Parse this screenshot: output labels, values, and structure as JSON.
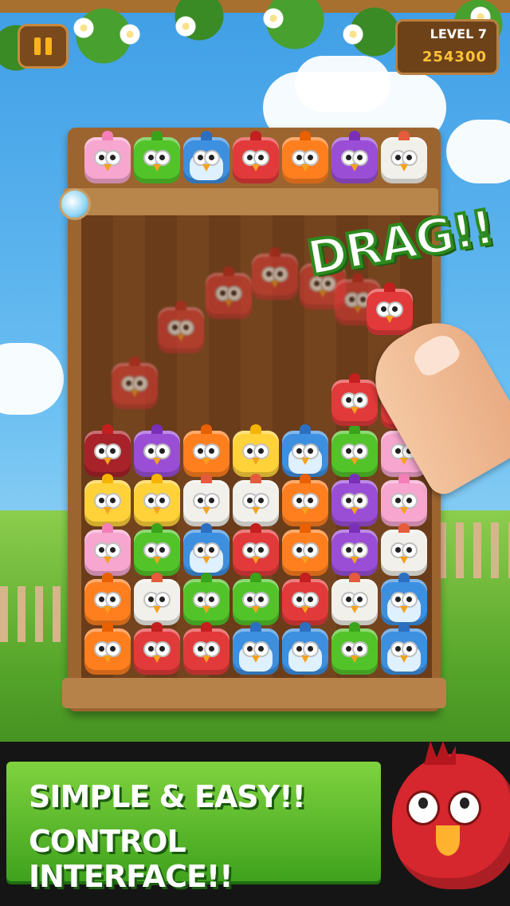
{
  "hud": {
    "pause_icon": "pause-icon",
    "level_label": "LEVEL 7",
    "score": "254300"
  },
  "board": {
    "preview_row": [
      "pink",
      "green",
      "blue",
      "red",
      "orange",
      "purple",
      "white"
    ],
    "grid": [
      [
        "red-dark",
        "purple",
        "orange",
        "yellow",
        "blue",
        "green",
        "pink"
      ],
      [
        "yellow",
        "yellow",
        "white",
        "white",
        "orange",
        "purple",
        "pink"
      ],
      [
        "pink",
        "green",
        "blue",
        "red",
        "orange",
        "purple",
        "white"
      ],
      [
        "orange",
        "white",
        "green",
        "green",
        "red",
        "white",
        "blue"
      ],
      [
        "orange",
        "red",
        "red",
        "blue",
        "blue",
        "green",
        "blue"
      ]
    ],
    "stack_extra": [
      "red",
      "red"
    ],
    "dragged_bird": "red"
  },
  "callout": {
    "drag_text": "DRAG!!"
  },
  "banner": {
    "line1": "SIMPLE & EASY!!",
    "line2": "CONTROL INTERFACE!!"
  },
  "colors": {
    "banner_green": "#52b52a",
    "board_wood": "#9c6530",
    "score_gold": "#ffc23a",
    "pause_orange": "#ffb21a"
  }
}
